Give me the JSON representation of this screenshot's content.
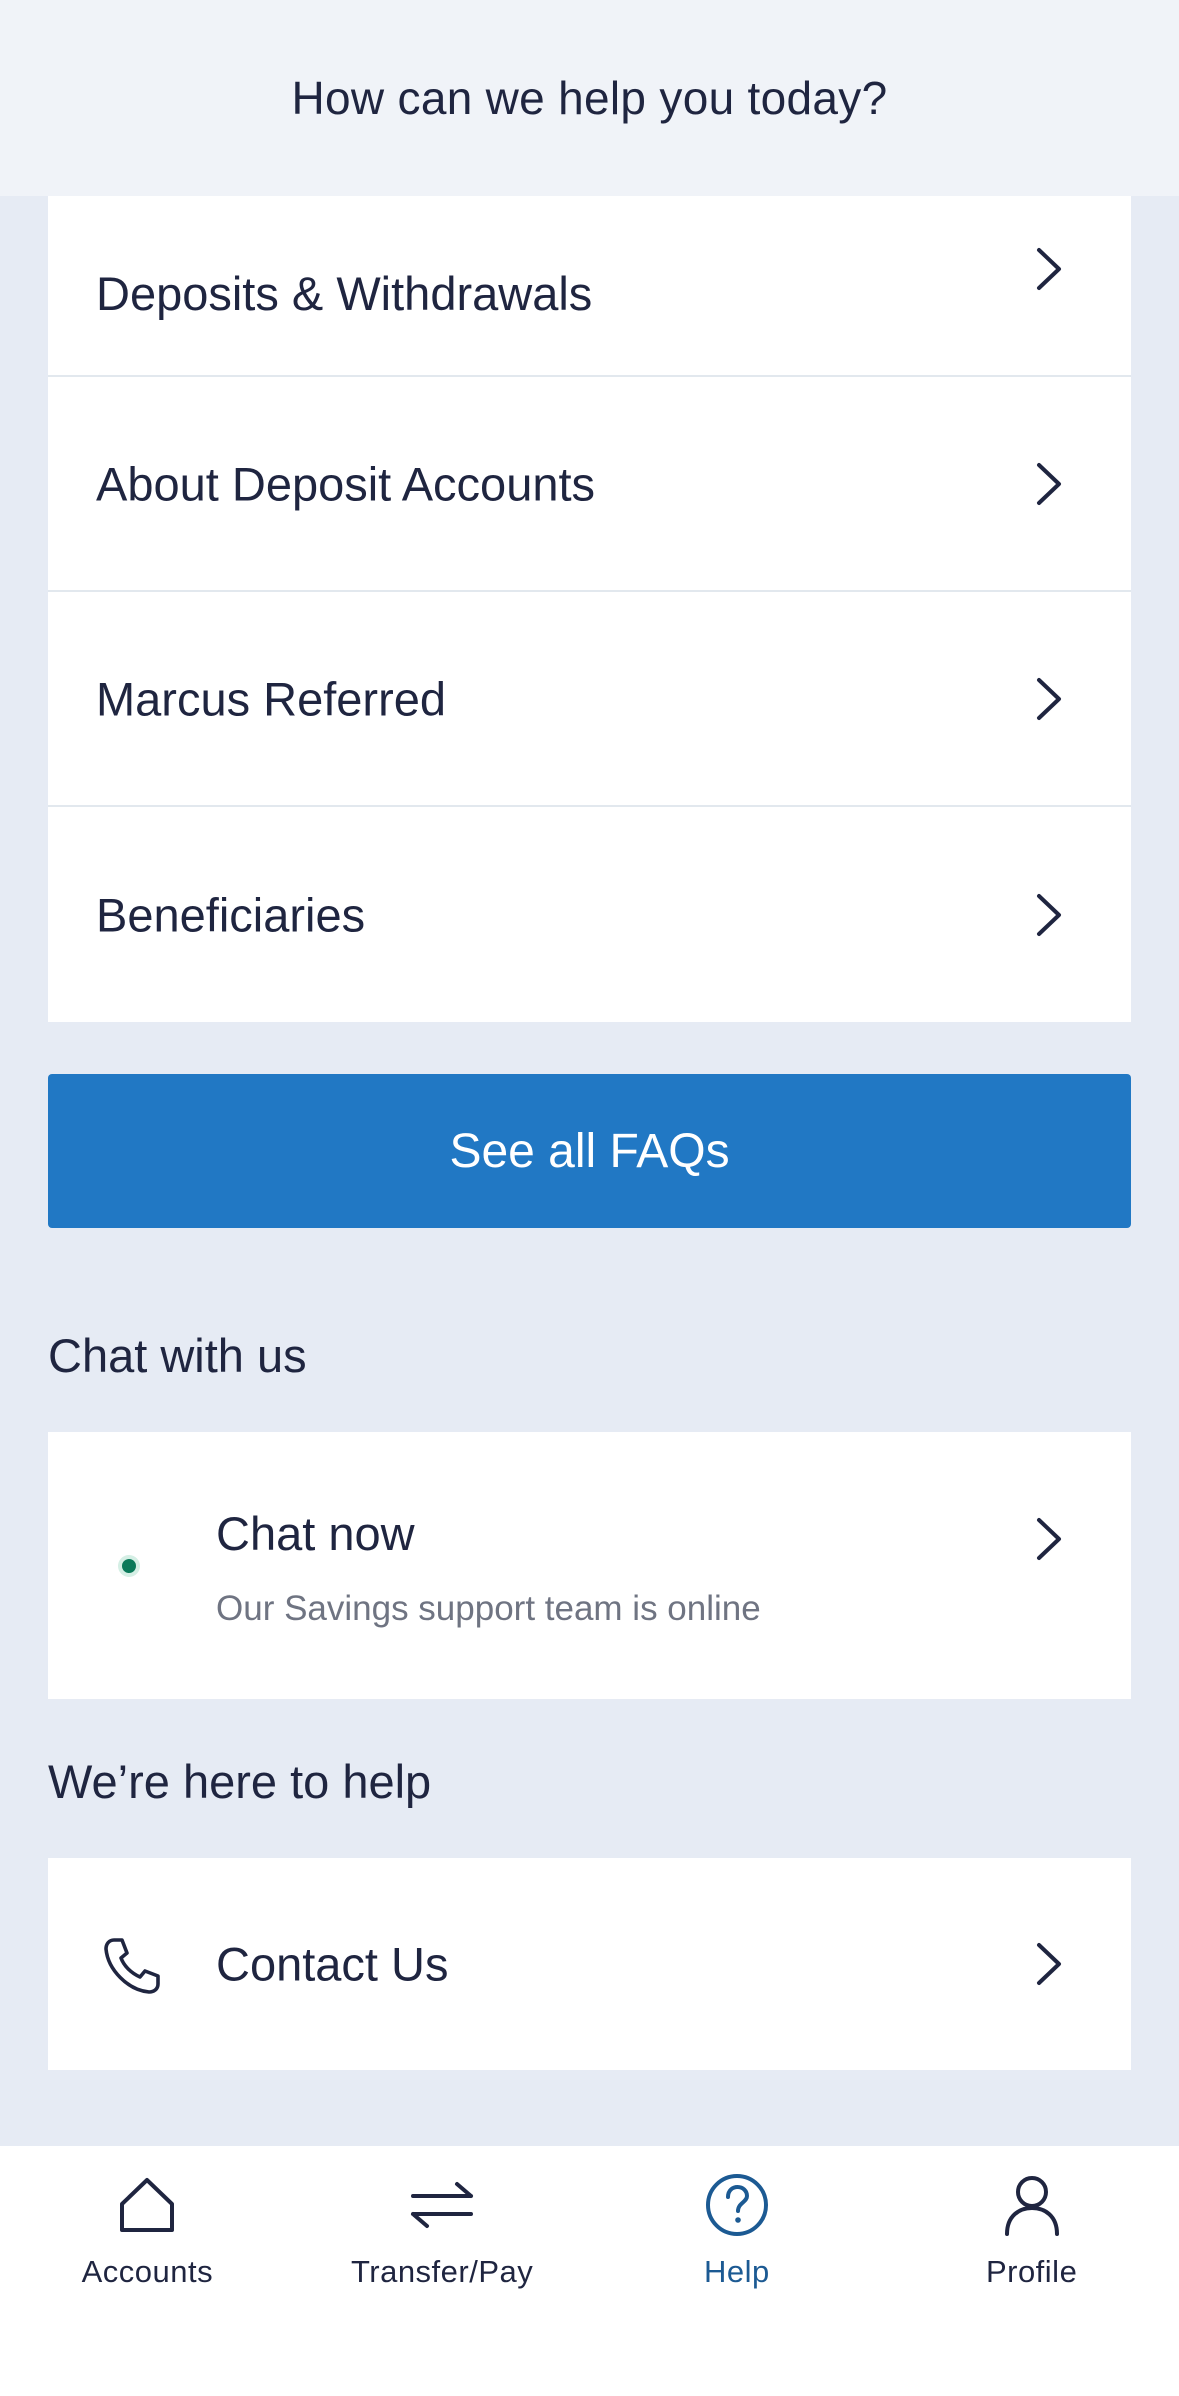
{
  "header": {
    "title": "How can we help you today?"
  },
  "faq": {
    "items": [
      {
        "label": "Deposits & Withdrawals"
      },
      {
        "label": "About Deposit Accounts"
      },
      {
        "label": "Marcus Referred"
      },
      {
        "label": "Beneficiaries"
      }
    ],
    "see_all_label": "See all FAQs"
  },
  "chat": {
    "heading": "Chat with us",
    "title": "Chat now",
    "subtitle": "Our Savings support team is online",
    "status_color": "#0b7a5a"
  },
  "help": {
    "heading": "We’re here to help",
    "contact_label": "Contact Us",
    "icon": "phone-icon"
  },
  "bottom_nav": {
    "active": "Help",
    "accent_color": "#1c5a93",
    "items": [
      {
        "label": "Accounts",
        "icon": "home-icon"
      },
      {
        "label": "Transfer/Pay",
        "icon": "transfer-arrows-icon"
      },
      {
        "label": "Help",
        "icon": "question-circle-icon"
      },
      {
        "label": "Profile",
        "icon": "person-icon"
      }
    ]
  },
  "colors": {
    "primary_button": "#2178c4",
    "background": "#e6ebf4",
    "header_background": "#f0f3f8",
    "text": "#1f2540",
    "secondary_text": "#6f7482"
  }
}
